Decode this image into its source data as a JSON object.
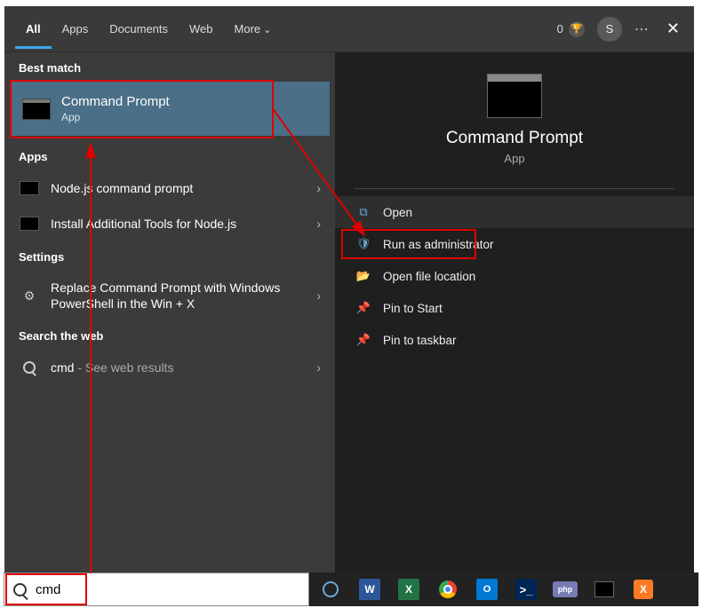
{
  "topbar": {
    "tabs": {
      "all": "All",
      "apps": "Apps",
      "documents": "Documents",
      "web": "Web",
      "more": "More"
    },
    "reward_count": "0",
    "avatar_initial": "S"
  },
  "left": {
    "best_match_label": "Best match",
    "best_match": {
      "title": "Command Prompt",
      "subtitle": "App"
    },
    "apps_label": "Apps",
    "app1": "Node.js command prompt",
    "app2": "Install Additional Tools for Node.js",
    "settings_label": "Settings",
    "setting1": "Replace Command Prompt with Windows PowerShell in the Win + X",
    "web_label": "Search the web",
    "web1_prefix": "cmd",
    "web1_suffix": " - See web results"
  },
  "right": {
    "title": "Command Prompt",
    "subtitle": "App",
    "actions": {
      "open": "Open",
      "admin": "Run as administrator",
      "location": "Open file location",
      "pin_start": "Pin to Start",
      "pin_taskbar": "Pin to taskbar"
    }
  },
  "search": {
    "value": "cmd"
  },
  "taskbar": {
    "word": "W",
    "excel": "X",
    "outlook": "O",
    "powershell": ">_",
    "php": "php",
    "xampp": "X"
  }
}
